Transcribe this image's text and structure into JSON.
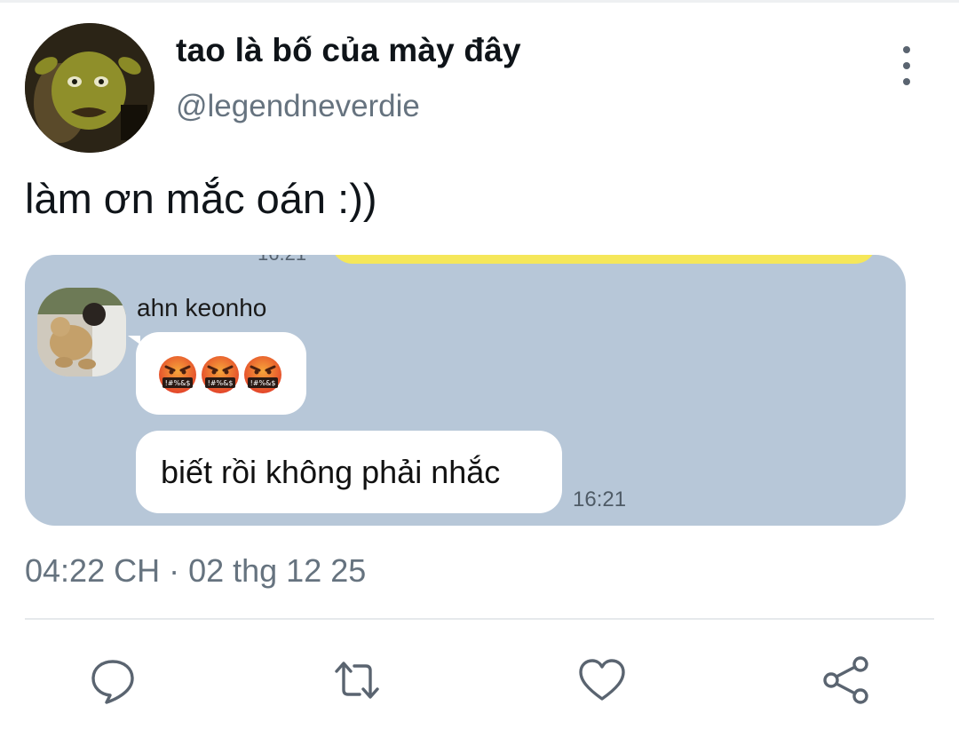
{
  "tweet": {
    "display_name": "tao là bố của mày đây",
    "handle": "@legendneverdie",
    "text": "làm ơn mắc oán :))",
    "timestamp": "04:22 CH · 02 thg 12 25"
  },
  "media": {
    "cut_time": "16:21",
    "sender_name": "ahn keonho",
    "emoji_text": "!#%&$",
    "emoji_count": 3,
    "message": "biết rồi không phải nhắc",
    "message_time": "16:21",
    "bg_color": "#b7c7d8"
  },
  "actions": {
    "icons": [
      "reply-icon",
      "retweet-icon",
      "like-icon",
      "share-icon"
    ],
    "icon_color": "#5a6470"
  }
}
